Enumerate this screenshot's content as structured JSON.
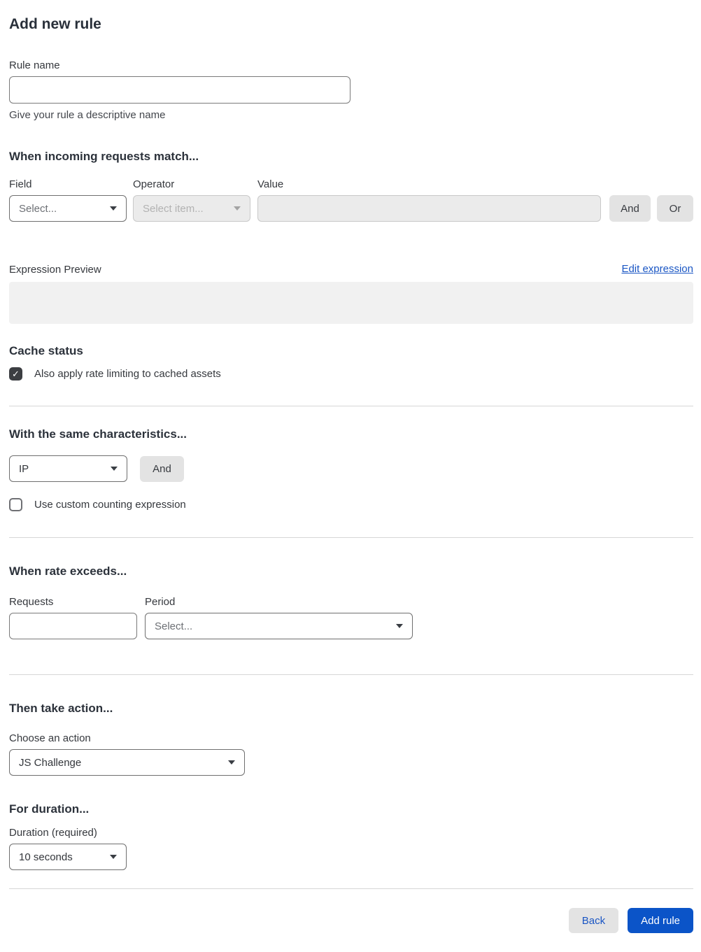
{
  "page": {
    "title": "Add new rule"
  },
  "colors": {
    "accent_blue": "#0b54c8",
    "link_blue": "#1a56c4",
    "button_gray": "#e3e3e3",
    "preview_gray": "#f1f1f1",
    "checkbox_dark": "#3c3e42"
  },
  "rule_name": {
    "label": "Rule name",
    "value": "",
    "helper": "Give your rule a descriptive name"
  },
  "match": {
    "heading": "When incoming requests match...",
    "field": {
      "label": "Field",
      "selected": "Select..."
    },
    "operator": {
      "label": "Operator",
      "selected": "Select item...",
      "disabled": true
    },
    "value": {
      "label": "Value",
      "value": "",
      "disabled": true
    },
    "and_label": "And",
    "or_label": "Or"
  },
  "expression": {
    "label": "Expression Preview",
    "edit_link": "Edit expression",
    "preview_value": ""
  },
  "cache": {
    "heading": "Cache status",
    "checkbox_label": "Also apply rate limiting to cached assets",
    "checked": true,
    "check_glyph": "✓"
  },
  "characteristics": {
    "heading": "With the same characteristics...",
    "selected": "IP",
    "and_label": "And",
    "checkbox_label": "Use custom counting expression",
    "checked": false
  },
  "rate": {
    "heading": "When rate exceeds...",
    "requests": {
      "label": "Requests",
      "value": ""
    },
    "period": {
      "label": "Period",
      "selected": "Select..."
    }
  },
  "action": {
    "heading": "Then take action...",
    "label": "Choose an action",
    "selected": "JS Challenge"
  },
  "duration": {
    "heading": "For duration...",
    "label": "Duration (required)",
    "selected": "10 seconds"
  },
  "footer": {
    "back_label": "Back",
    "submit_label": "Add rule"
  }
}
